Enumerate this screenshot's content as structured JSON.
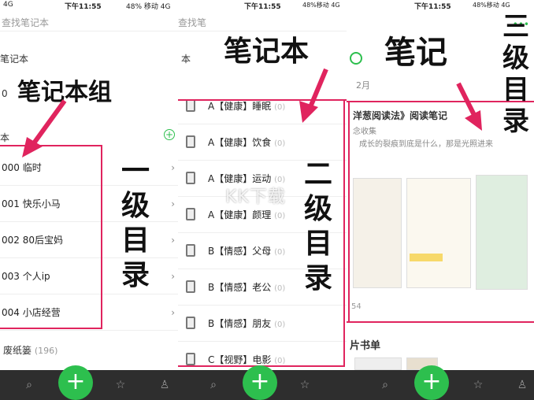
{
  "panel1": {
    "status_time": "下午11:55",
    "status_left": "4G",
    "status_right": "48% 移动 4G",
    "search_placeholder": "查找笔记本",
    "section_notebooks": "笔记本",
    "zero": "0",
    "section_group": "本",
    "plus_symbol": "+",
    "items": [
      {
        "label": "000 临时",
        "icon": "red-pin-icon"
      },
      {
        "label": "001 快乐小马",
        "icon": "horse-icon"
      },
      {
        "label": "002 80后宝妈",
        "icon": "bottle-icon"
      },
      {
        "label": "003 个人ip",
        "icon": "diamond-icon"
      },
      {
        "label": "004 小店经营",
        "icon": "moneybag-icon"
      }
    ],
    "trash": "废纸篓",
    "trash_count": "(196)",
    "annot_group": "笔记本组",
    "annot_level1": "一级目录"
  },
  "panel2": {
    "status_time": "下午11:55",
    "status_right": "48%移动 4G",
    "search_placeholder": "查找笔",
    "section": "本",
    "items": [
      {
        "prefix": "A",
        "label": "【健康】睡眠",
        "count": "(0)"
      },
      {
        "prefix": "A",
        "label": "【健康】饮食",
        "count": "(0)"
      },
      {
        "prefix": "A",
        "label": "【健康】运动",
        "count": "(0)"
      },
      {
        "prefix": "A",
        "label": "【健康】颜理",
        "count": "(0)"
      },
      {
        "prefix": "B",
        "label": "【情感】父母",
        "count": "(0)"
      },
      {
        "prefix": "B",
        "label": "【情感】老公",
        "count": "(0)"
      },
      {
        "prefix": "B",
        "label": "【情感】朋友",
        "count": "(0)"
      },
      {
        "prefix": "C",
        "label": "【视野】电影",
        "count": "(0)"
      }
    ],
    "annot_notebook": "笔记本",
    "annot_level2": "二级目录"
  },
  "panel3": {
    "status_time": "下午11:55",
    "status_right": "48%移动 4G",
    "month": "2月",
    "note_title": "洋葱阅读法》阅读笔记",
    "note_sub": "念收集",
    "note_quote": "成长的裂痕到底是什么，那是光照进来",
    "number": "54",
    "booklist": "片书单",
    "annot_note": "笔记",
    "annot_level3": "三级目录"
  },
  "watermark": "KK下载"
}
